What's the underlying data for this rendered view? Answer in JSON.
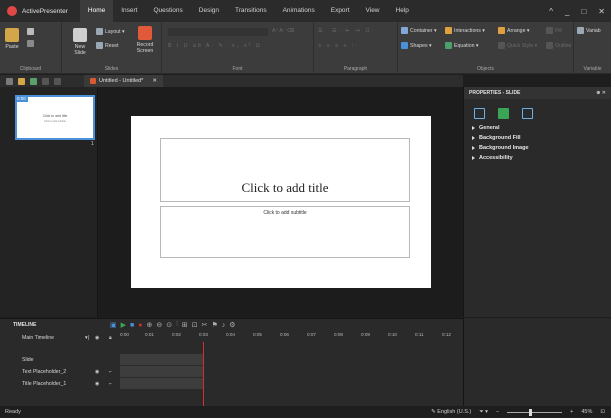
{
  "app": {
    "name": "ActivePresenter"
  },
  "menu": {
    "tabs": [
      "Home",
      "Insert",
      "Questions",
      "Design",
      "Transitions",
      "Animations",
      "Export",
      "View",
      "Help"
    ],
    "active": "Home"
  },
  "window_controls": {
    "caret": "^",
    "minimize": "_",
    "restore": "□",
    "close": "✕"
  },
  "ribbon": {
    "clipboard": {
      "label": "Clipboard",
      "paste": "Paste"
    },
    "slides": {
      "label": "Slides",
      "new_slide": "New Slide",
      "layout": "Layout",
      "reset": "Reset",
      "record_screen": "Record Screen"
    },
    "font": {
      "label": "Font"
    },
    "paragraph": {
      "label": "Paragraph"
    },
    "objects": {
      "label": "Objects",
      "container": "Container",
      "interactions": "Interactions",
      "arrange": "Arrange",
      "shapes": "Shapes",
      "equation": "Equation",
      "quick_style": "Quick Style",
      "fill": "Fill",
      "outline": "Outline"
    },
    "variables": {
      "label": "Variable",
      "variab": "Variab"
    }
  },
  "document": {
    "tab_title": "Untitled - Untitled*",
    "tab_close": "✕"
  },
  "slides_panel": {
    "thumb_number_badge": "0:00",
    "thumb_title": "Click to add title",
    "thumb_subtitle": "Click to add subtitle",
    "index": "1"
  },
  "slide": {
    "title_placeholder": "Click to add title",
    "subtitle_placeholder": "Click to add subtitle"
  },
  "properties": {
    "header": "PROPERTIES - SLIDE",
    "sections": [
      "General",
      "Background Fill",
      "Background Image",
      "Accessibility"
    ]
  },
  "timeline": {
    "header": "TIMELINE",
    "main_timeline": "Main Timeline",
    "ruler": [
      "0:00",
      "0:01",
      "0:02",
      "0:03",
      "0:04",
      "0:05",
      "0:06",
      "0:07",
      "0:08",
      "0:09",
      "0:10",
      "0:11",
      "0:12"
    ],
    "rows": [
      "Slide",
      "Text Placeholder_2",
      "Title Placeholder_1"
    ]
  },
  "status": {
    "ready": "Ready",
    "language": "English (U.S.)",
    "zoom": "45%"
  },
  "colors": {
    "accent_blue": "#4a90d9",
    "brand_red": "#e04848",
    "play_green": "#3aa655",
    "record_red": "#d03030"
  }
}
